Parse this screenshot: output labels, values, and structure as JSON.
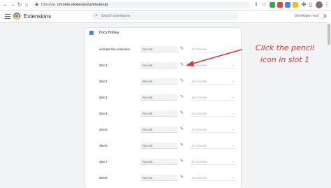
{
  "browser": {
    "site_label": "Chrome",
    "separator": "|",
    "url": "chrome://extensions/shortcuts"
  },
  "header": {
    "title": "Extensions",
    "search_placeholder": "Search extensions",
    "developer_mode_label": "Developer mode",
    "developer_mode_on": false
  },
  "extension": {
    "name": "Docs Hotkey",
    "rows": [
      {
        "label": "Activate the extension",
        "shortcut": "Not set",
        "scope": "In Chrome"
      },
      {
        "label": "Slot 1",
        "shortcut": "Not set",
        "scope": "In Chrome"
      },
      {
        "label": "Slot 2",
        "shortcut": "Not set",
        "scope": "In Chrome"
      },
      {
        "label": "Slot 3",
        "shortcut": "Not set",
        "scope": "In Chrome"
      },
      {
        "label": "Slot 4",
        "shortcut": "Not set",
        "scope": "In Chrome"
      },
      {
        "label": "Slot 5",
        "shortcut": "Not set",
        "scope": "In Chrome"
      },
      {
        "label": "Slot 6",
        "shortcut": "Not set",
        "scope": "In Chrome"
      },
      {
        "label": "Slot 7",
        "shortcut": "Not set",
        "scope": "In Chrome"
      },
      {
        "label": "Slot 8",
        "shortcut": "Not set",
        "scope": "In Chrome"
      }
    ]
  },
  "annotation": {
    "line1": "Click the pencil",
    "line2": "icon in slot 1",
    "color": "#e8302f"
  }
}
